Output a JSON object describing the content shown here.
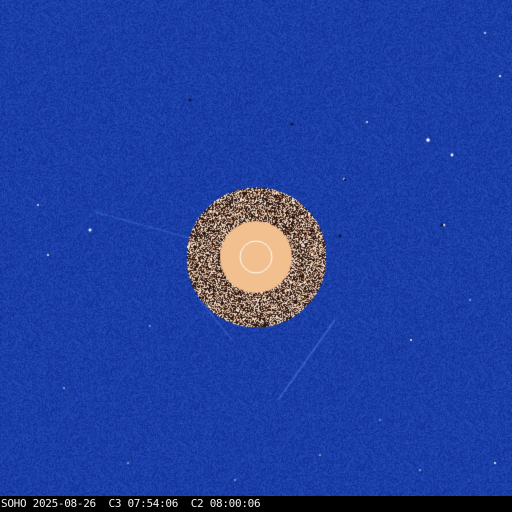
{
  "image": {
    "subject": "LASCO C3/C2 composite coronagraph image",
    "caption_observatory": "SOHO",
    "caption_date": "2025-08-26",
    "caption_c3": "C3 07:54:06",
    "caption_c2": "C2 08:00:06",
    "colors": {
      "background_sky": "#1d3fa8",
      "occulter_disk": "#f2bf8e",
      "sun_outline": "#ffffff",
      "caption_bar": "#000000",
      "caption_text": "#f2f2f2"
    }
  }
}
